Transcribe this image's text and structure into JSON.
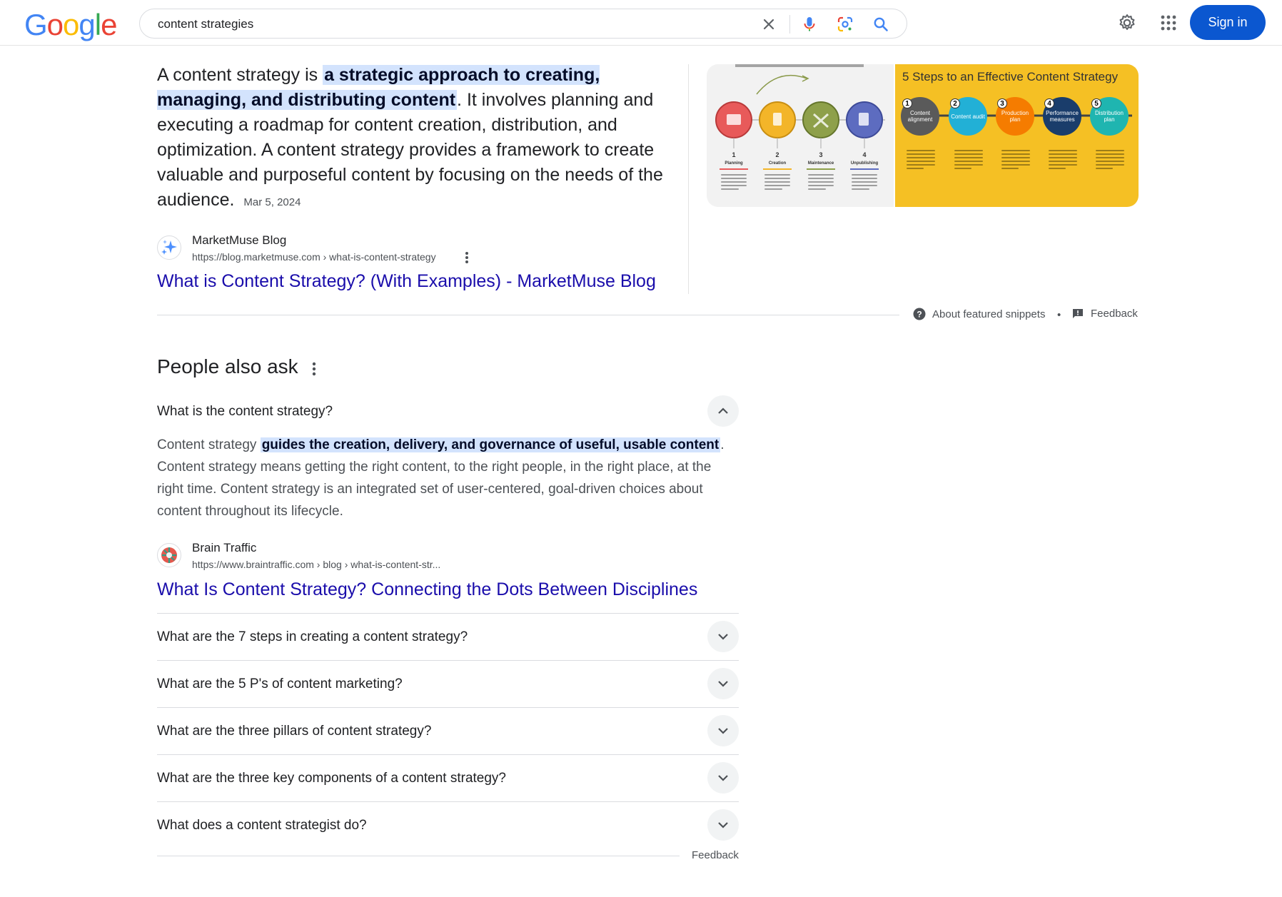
{
  "header": {
    "logo_letters": [
      "G",
      "o",
      "o",
      "g",
      "l",
      "e"
    ],
    "query": "content strategies",
    "sign_in_label": "Sign in"
  },
  "snippet": {
    "text_before": "A content strategy is ",
    "highlight": "a strategic approach to creating, managing, and distributing content",
    "text_after": ". It involves planning and executing a roadmap for content creation, distribution, and optimization. A content strategy provides a framework to create valuable and purposeful content by focusing on the needs of the audience.",
    "date": "Mar 5, 2024",
    "source_name": "MarketMuse Blog",
    "source_url": "https://blog.marketmuse.com › what-is-content-strategy",
    "link_title": "What is Content Strategy? (With Examples) - MarketMuse Blog",
    "image1": {
      "steps": [
        {
          "n": "1",
          "label": "Planning"
        },
        {
          "n": "2",
          "label": "Creation"
        },
        {
          "n": "3",
          "label": "Maintenance"
        },
        {
          "n": "4",
          "label": "Unpublishing"
        }
      ]
    },
    "image2": {
      "title": "5 Steps to an Effective Content Strategy",
      "steps": [
        {
          "n": "1",
          "label": "Content alignment"
        },
        {
          "n": "2",
          "label": "Content audit"
        },
        {
          "n": "3",
          "label": "Production plan"
        },
        {
          "n": "4",
          "label": "Performance measures"
        },
        {
          "n": "5",
          "label": "Distribution plan"
        }
      ]
    },
    "about_label": "About featured snippets",
    "feedback_label": "Feedback"
  },
  "paa": {
    "title": "People also ask",
    "expanded": {
      "question": "What is the content strategy?",
      "answer_before": "Content strategy ",
      "answer_highlight": "guides the creation, delivery, and governance of useful, usable content",
      "answer_after": ". Content strategy means getting the right content, to the right people, in the right place, at the right time. Content strategy is an integrated set of user-centered, goal-driven choices about content throughout its lifecycle.",
      "source_name": "Brain Traffic",
      "source_url": "https://www.braintraffic.com › blog › what-is-content-str...",
      "link_title": "What Is Content Strategy? Connecting the Dots Between Disciplines"
    },
    "questions": [
      "What are the 7 steps in creating a content strategy?",
      "What are the 5 P's of content marketing?",
      "What are the three pillars of content strategy?",
      "What are the three key components of a content strategy?",
      "What does a content strategist do?"
    ],
    "feedback_label": "Feedback"
  },
  "colors": {
    "accent": "#0b57d0",
    "link": "#1a0dab",
    "highlight": "#d3e3fd"
  }
}
